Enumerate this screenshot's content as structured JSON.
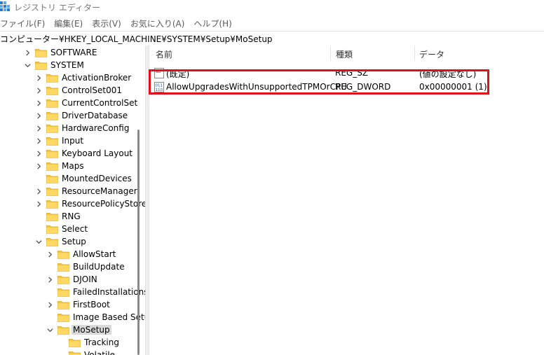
{
  "window": {
    "title": "レジストリ エディター"
  },
  "menu": {
    "items": [
      "ファイル(F)",
      "編集(E)",
      "表示(V)",
      "お気に入り(A)",
      "ヘルプ(H)"
    ]
  },
  "address": {
    "path": "コンピューター¥HKEY_LOCAL_MACHINE¥SYSTEM¥Setup¥MoSetup"
  },
  "tree": {
    "nodes": [
      {
        "label": "SOFTWARE",
        "expand": "collapsed",
        "level": 0
      },
      {
        "label": "SYSTEM",
        "expand": "expanded",
        "level": 0
      },
      {
        "label": "ActivationBroker",
        "expand": "collapsed",
        "level": 1
      },
      {
        "label": "ControlSet001",
        "expand": "collapsed",
        "level": 1
      },
      {
        "label": "CurrentControlSet",
        "expand": "collapsed",
        "level": 1
      },
      {
        "label": "DriverDatabase",
        "expand": "collapsed",
        "level": 1
      },
      {
        "label": "HardwareConfig",
        "expand": "collapsed",
        "level": 1
      },
      {
        "label": "Input",
        "expand": "collapsed",
        "level": 1
      },
      {
        "label": "Keyboard Layout",
        "expand": "collapsed",
        "level": 1
      },
      {
        "label": "Maps",
        "expand": "collapsed",
        "level": 1
      },
      {
        "label": "MountedDevices",
        "expand": "none",
        "level": 1
      },
      {
        "label": "ResourceManager",
        "expand": "collapsed",
        "level": 1
      },
      {
        "label": "ResourcePolicyStore",
        "expand": "collapsed",
        "level": 1
      },
      {
        "label": "RNG",
        "expand": "none",
        "level": 1
      },
      {
        "label": "Select",
        "expand": "none",
        "level": 1
      },
      {
        "label": "Setup",
        "expand": "expanded",
        "level": 1
      },
      {
        "label": "AllowStart",
        "expand": "collapsed",
        "level": 2
      },
      {
        "label": "BuildUpdate",
        "expand": "none",
        "level": 2
      },
      {
        "label": "DJOIN",
        "expand": "collapsed",
        "level": 2
      },
      {
        "label": "FailedInstallations",
        "expand": "none",
        "level": 2
      },
      {
        "label": "FirstBoot",
        "expand": "collapsed",
        "level": 2
      },
      {
        "label": "Image Based Setu",
        "expand": "none",
        "level": 2
      },
      {
        "label": "MoSetup",
        "expand": "expanded",
        "level": 2,
        "selected": true
      },
      {
        "label": "Tracking",
        "expand": "none",
        "level": 3
      },
      {
        "label": "Volatile",
        "expand": "none",
        "level": 3
      }
    ]
  },
  "list": {
    "columns": [
      "名前",
      "種類",
      "データ"
    ],
    "rows": [
      {
        "name": "(既定)",
        "type": "REG_SZ",
        "data": "(値の設定なし)",
        "icon": "string-value-icon"
      },
      {
        "name": "AllowUpgradesWithUnsupportedTPMOrCPU",
        "type": "REG_DWORD",
        "data": "0x00000001 (1)",
        "icon": "dword-value-icon"
      }
    ]
  },
  "colors": {
    "highlight": "#e0101a",
    "folder": "#f5c542",
    "selection": "#d9d9d9"
  }
}
